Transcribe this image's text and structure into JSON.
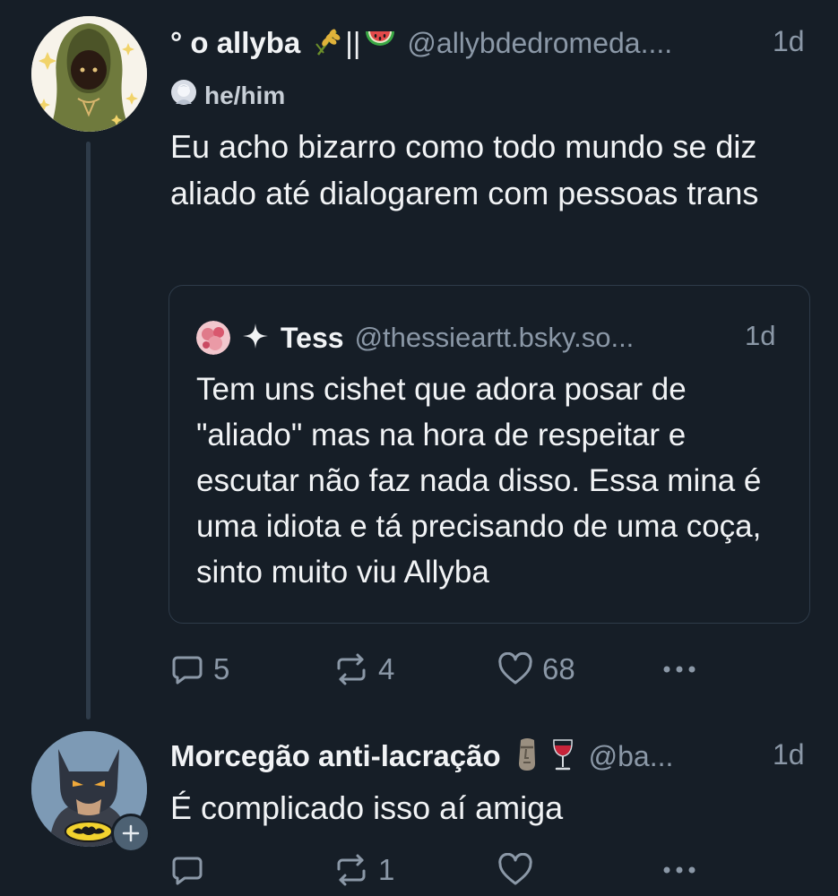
{
  "post1": {
    "display_name": "° o allyba",
    "name_separator": "||",
    "handle": "@allybdedromeda....",
    "time": "1d",
    "pronouns": "he/him",
    "text": "Eu acho bizarro como todo mundo se diz aliado até dialogarem com pessoas trans",
    "quote": {
      "display_name": "Tess",
      "handle": "@thessieartt.bsky.so...",
      "time": "1d",
      "text": "Tem uns cishet que adora posar de \"aliado\" mas na hora de respeitar e escutar não faz nada disso. Essa mina é uma idiota e tá precisando de uma coça, sinto muito viu Allyba"
    },
    "actions": {
      "replies": "5",
      "reposts": "4",
      "likes": "68"
    }
  },
  "post2": {
    "display_name": "Morcegão anti-lacração",
    "handle": "@ba...",
    "time": "1d",
    "text": "É complicado isso aí amiga",
    "actions": {
      "replies": "",
      "reposts": "1",
      "likes": ""
    }
  },
  "icons": {
    "reply": "speech-bubble-icon",
    "repost": "repost-arrows-icon",
    "like": "heart-icon",
    "more": "ellipsis-icon",
    "follow": "plus-icon"
  },
  "colors": {
    "background": "#161e27",
    "text": "#f1f3f5",
    "muted": "#8b98a7",
    "border": "#2e3b49"
  }
}
